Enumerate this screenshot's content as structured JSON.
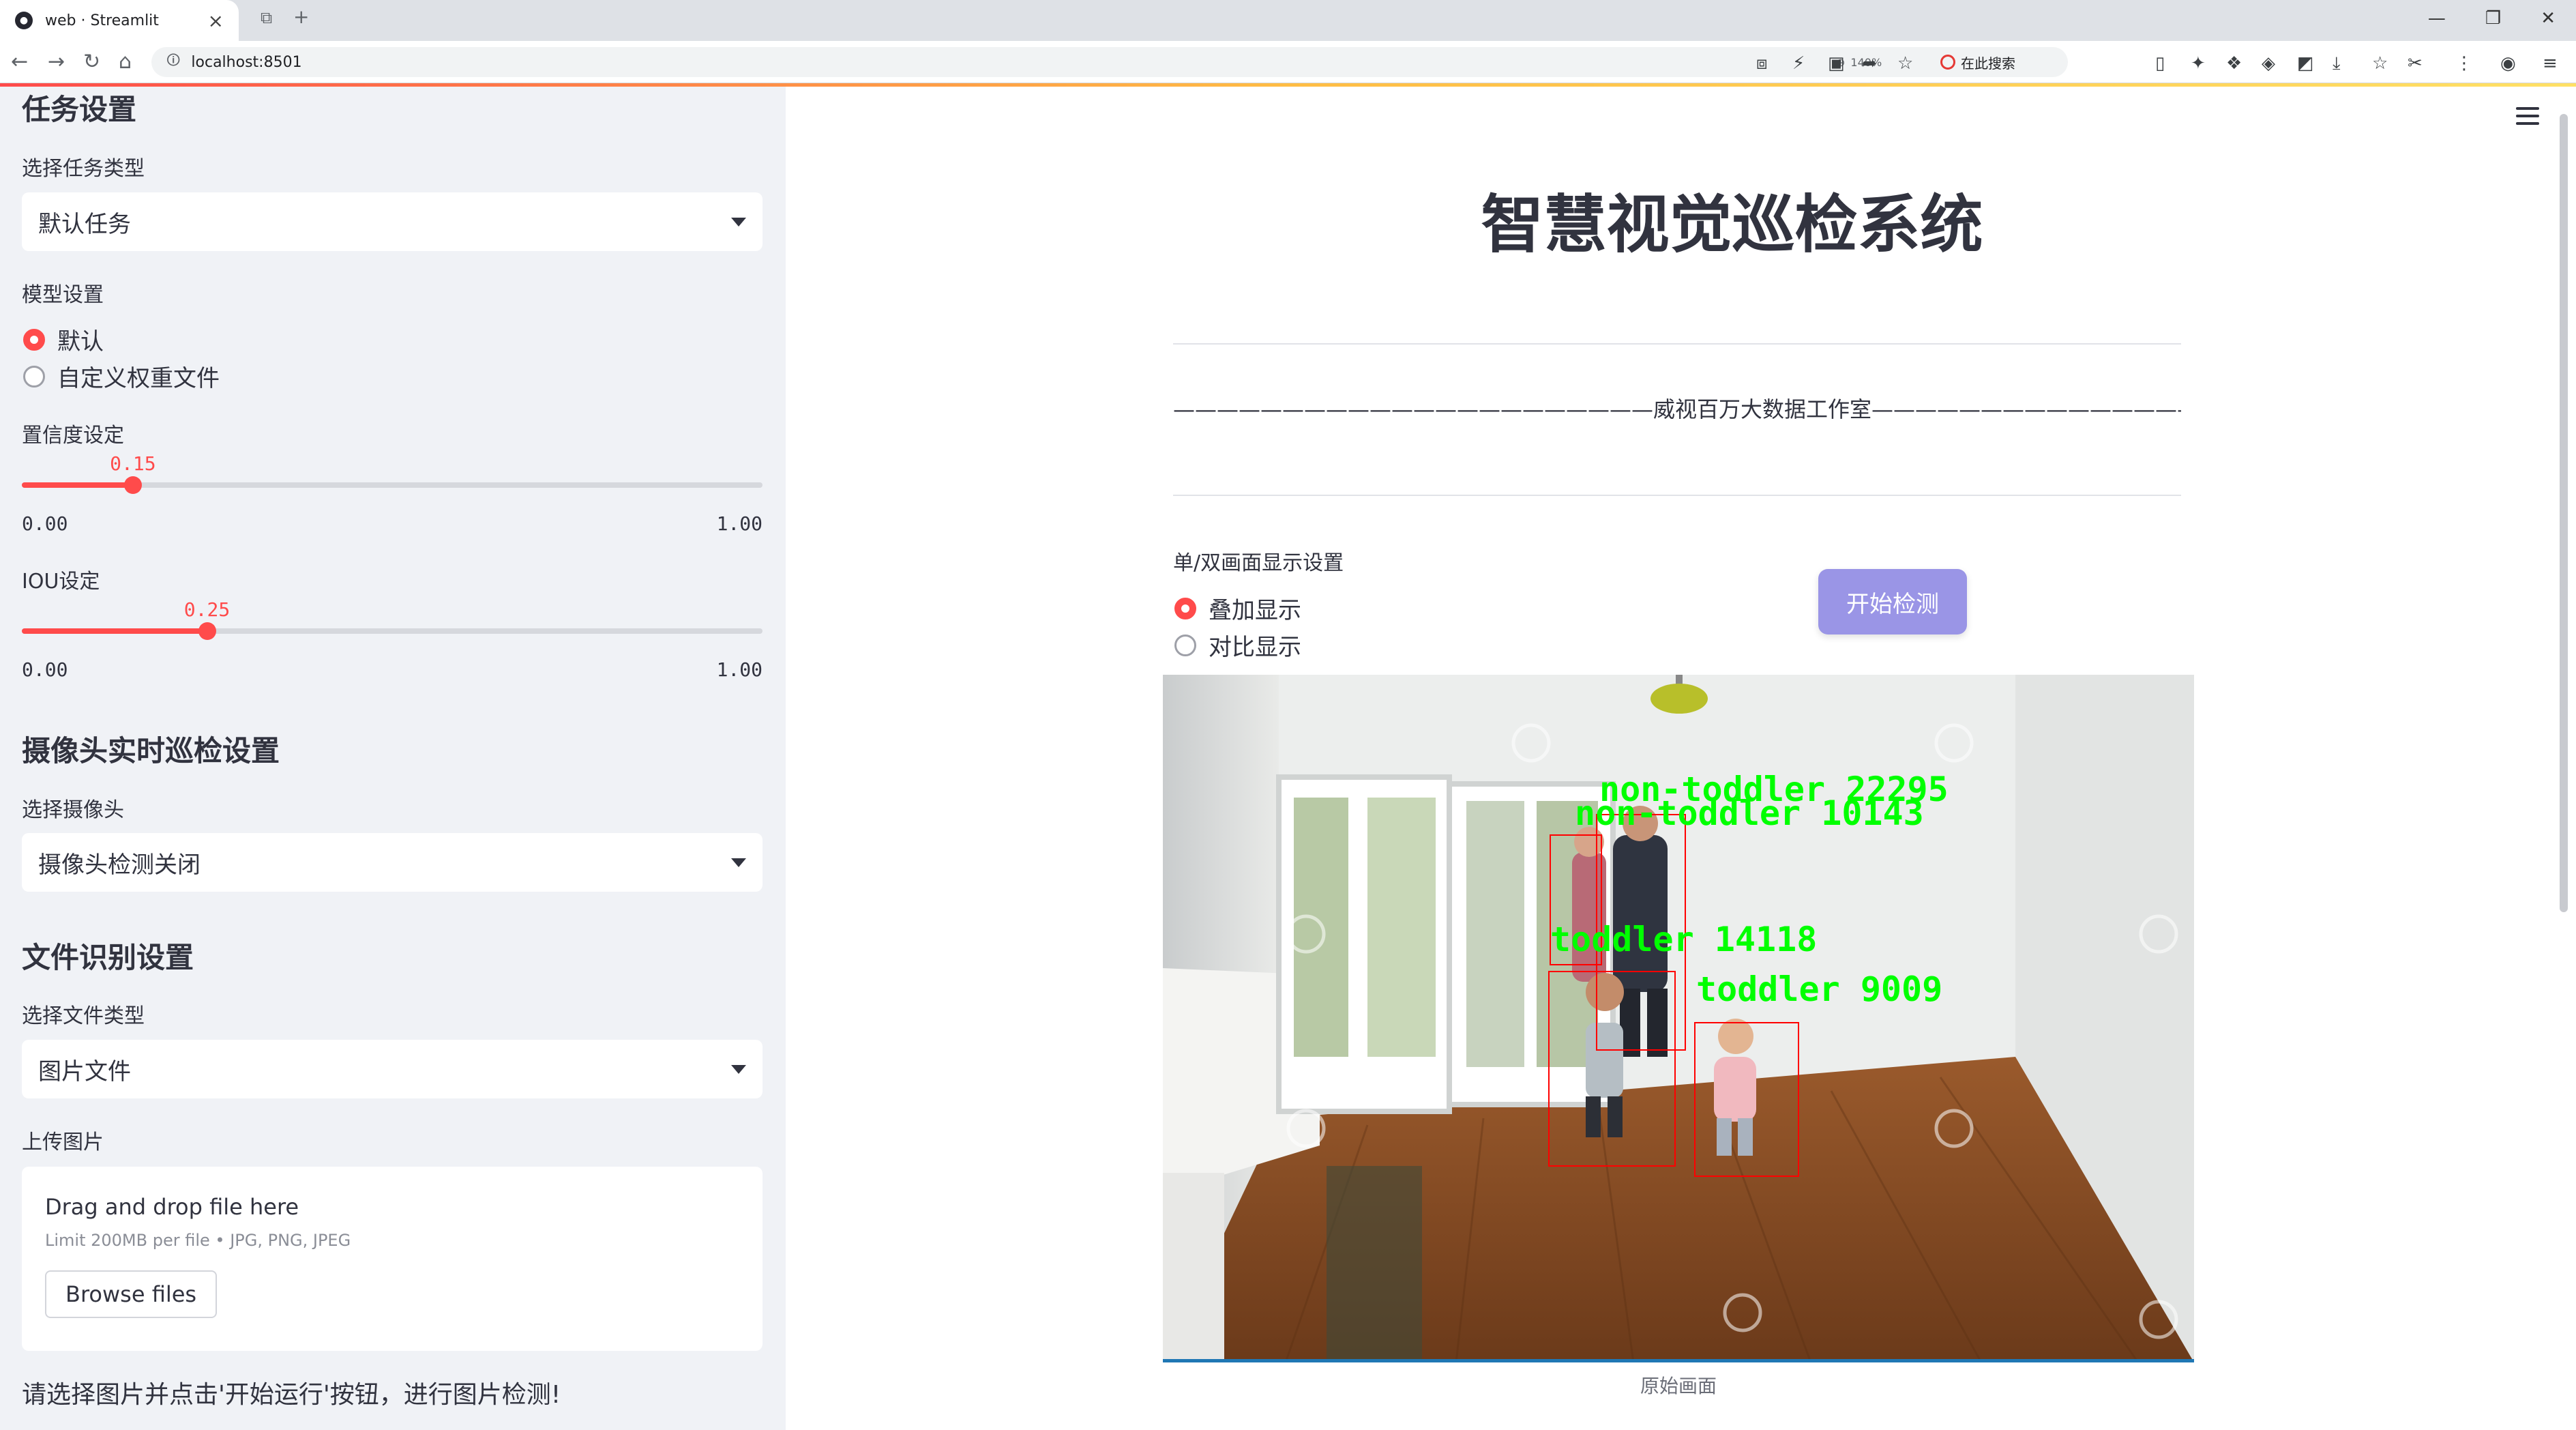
{
  "browser": {
    "tab_title": "web · Streamlit",
    "url": "localhost:8501",
    "zoom": "140%",
    "search_placeholder": "在此搜索"
  },
  "sidebar": {
    "task_section": "任务设置",
    "task_type_label": "选择任务类型",
    "task_type_value": "默认任务",
    "model_label": "模型设置",
    "model_options": [
      "默认",
      "自定义权重文件"
    ],
    "model_selected": 0,
    "conf_label": "置信度设定",
    "conf": {
      "value": "0.15",
      "min": "0.00",
      "max": "1.00",
      "fraction": 0.15
    },
    "iou_label": "IOU设定",
    "iou": {
      "value": "0.25",
      "min": "0.00",
      "max": "1.00",
      "fraction": 0.25
    },
    "camera_section": "摄像头实时巡检设置",
    "camera_label": "选择摄像头",
    "camera_value": "摄像头检测关闭",
    "file_section": "文件识别设置",
    "file_type_label": "选择文件类型",
    "file_type_value": "图片文件",
    "upload_label": "上传图片",
    "upload": {
      "title": "Drag and drop file here",
      "limit": "Limit 200MB per file • JPG, PNG, JPEG",
      "button": "Browse files"
    },
    "hint": "请选择图片并点击'开始运行'按钮，进行图片检测!"
  },
  "main": {
    "title": "智慧视觉巡检系统",
    "subtitle": "——————————————————————威视百万大数据工作室——————————————————————",
    "display_label": "单/双画面显示设置",
    "display_options": [
      "叠加显示",
      "对比显示"
    ],
    "display_selected": 0,
    "start_button": "开始检测",
    "image_caption": "原始画面",
    "detections": [
      {
        "label": "non-toddler 22295"
      },
      {
        "label": "non-toddler 10143"
      },
      {
        "label": "toddler 14118"
      },
      {
        "label": "toddler 9009"
      }
    ],
    "colors": {
      "accent": "#ff4b4b",
      "button": "#9a95e6",
      "detection_box": "#ff0000",
      "detection_text": "#00ff00"
    }
  }
}
